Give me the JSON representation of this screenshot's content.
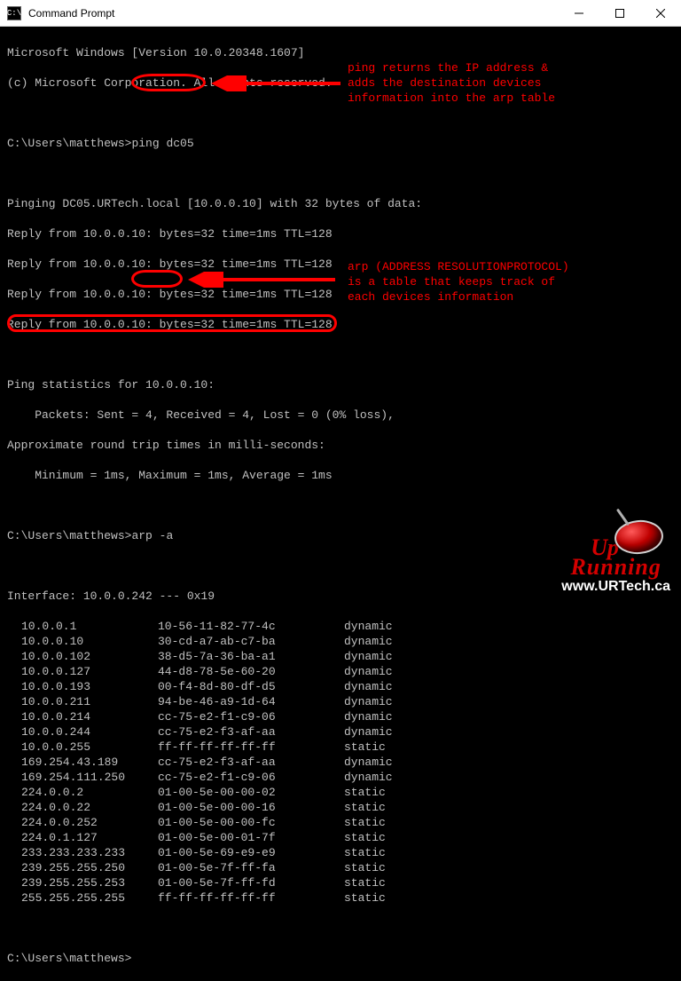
{
  "window": {
    "title": "Command Prompt",
    "icon_text": "C:\\"
  },
  "header": {
    "line1": "Microsoft Windows [Version 10.0.20348.1607]",
    "line2": "(c) Microsoft Corporation. All rights reserved."
  },
  "prompt_prefix": "C:\\Users\\matthews>",
  "commands": {
    "ping": "ping dc05",
    "arp": "arp -a"
  },
  "annotations": {
    "ping": "ping returns the IP address &\nadds the destination devices\ninformation into the arp table",
    "arp": "arp (ADDRESS RESOLUTIONPROTOCOL)\nis a table that keeps track of\neach devices information"
  },
  "ping_output": {
    "header": "Pinging DC05.URTech.local [10.0.0.10] with 32 bytes of data:",
    "replies": [
      "Reply from 10.0.0.10: bytes=32 time=1ms TTL=128",
      "Reply from 10.0.0.10: bytes=32 time=1ms TTL=128",
      "Reply from 10.0.0.10: bytes=32 time=1ms TTL=128",
      "Reply from 10.0.0.10: bytes=32 time=1ms TTL=128"
    ],
    "stats_header": "Ping statistics for 10.0.0.10:",
    "packets": "    Packets: Sent = 4, Received = 4, Lost = 0 (0% loss),",
    "rt_header": "Approximate round trip times in milli-seconds:",
    "rt_values": "    Minimum = 1ms, Maximum = 1ms, Average = 1ms"
  },
  "arp_output": {
    "interface": "Interface: 10.0.0.242 --- 0x19",
    "rows": [
      {
        "ip": "10.0.0.1",
        "mac": "10-56-11-82-77-4c",
        "type": "dynamic"
      },
      {
        "ip": "10.0.0.10",
        "mac": "30-cd-a7-ab-c7-ba",
        "type": "dynamic"
      },
      {
        "ip": "10.0.0.102",
        "mac": "38-d5-7a-36-ba-a1",
        "type": "dynamic"
      },
      {
        "ip": "10.0.0.127",
        "mac": "44-d8-78-5e-60-20",
        "type": "dynamic"
      },
      {
        "ip": "10.0.0.193",
        "mac": "00-f4-8d-80-df-d5",
        "type": "dynamic"
      },
      {
        "ip": "10.0.0.211",
        "mac": "94-be-46-a9-1d-64",
        "type": "dynamic"
      },
      {
        "ip": "10.0.0.214",
        "mac": "cc-75-e2-f1-c9-06",
        "type": "dynamic"
      },
      {
        "ip": "10.0.0.244",
        "mac": "cc-75-e2-f3-af-aa",
        "type": "dynamic"
      },
      {
        "ip": "10.0.0.255",
        "mac": "ff-ff-ff-ff-ff-ff",
        "type": "static"
      },
      {
        "ip": "169.254.43.189",
        "mac": "cc-75-e2-f3-af-aa",
        "type": "dynamic"
      },
      {
        "ip": "169.254.111.250",
        "mac": "cc-75-e2-f1-c9-06",
        "type": "dynamic"
      },
      {
        "ip": "224.0.0.2",
        "mac": "01-00-5e-00-00-02",
        "type": "static"
      },
      {
        "ip": "224.0.0.22",
        "mac": "01-00-5e-00-00-16",
        "type": "static"
      },
      {
        "ip": "224.0.0.252",
        "mac": "01-00-5e-00-00-fc",
        "type": "static"
      },
      {
        "ip": "224.0.1.127",
        "mac": "01-00-5e-00-01-7f",
        "type": "static"
      },
      {
        "ip": "233.233.233.233",
        "mac": "01-00-5e-69-e9-e9",
        "type": "static"
      },
      {
        "ip": "239.255.255.250",
        "mac": "01-00-5e-7f-ff-fa",
        "type": "static"
      },
      {
        "ip": "239.255.255.253",
        "mac": "01-00-5e-7f-ff-fd",
        "type": "static"
      },
      {
        "ip": "255.255.255.255",
        "mac": "ff-ff-ff-ff-ff-ff",
        "type": "static"
      }
    ]
  },
  "logo": {
    "up": "Up",
    "running": "Running",
    "url": "www.URTech.ca"
  }
}
